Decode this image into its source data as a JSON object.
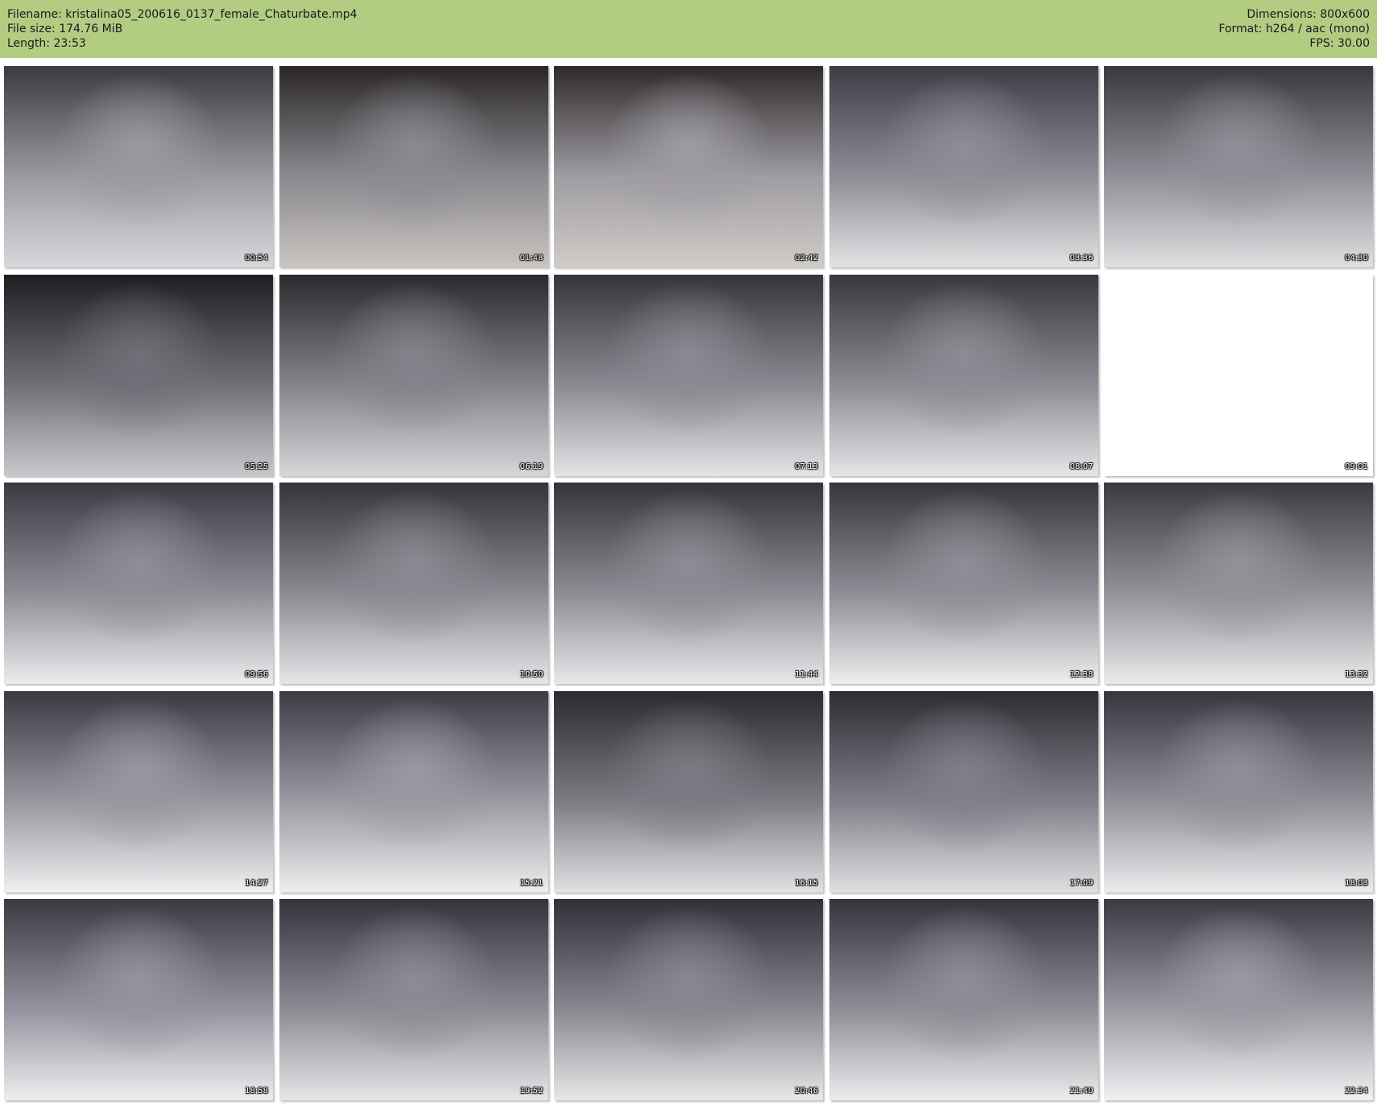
{
  "header": {
    "filename": "Filename: kristalina05_200616_0137_female_Chaturbate.mp4",
    "filesize": "File size: 174.76 MiB",
    "length": "Length: 23:53",
    "dimensions": "Dimensions: 800x600",
    "format": "Format: h264 / aac (mono)",
    "fps": "FPS: 30.00"
  },
  "colors": {
    "header_bg": "#b2cc82",
    "page_bg": "#ffffff"
  },
  "thumbnails": [
    {
      "time": "00:54"
    },
    {
      "time": "01:48"
    },
    {
      "time": "02:42"
    },
    {
      "time": "03:36"
    },
    {
      "time": "04:30"
    },
    {
      "time": "05:25"
    },
    {
      "time": "06:19"
    },
    {
      "time": "07:13"
    },
    {
      "time": "08:07"
    },
    {
      "time": "09:01"
    },
    {
      "time": "09:56"
    },
    {
      "time": "10:50"
    },
    {
      "time": "11:44"
    },
    {
      "time": "12:38"
    },
    {
      "time": "13:32"
    },
    {
      "time": "14:27"
    },
    {
      "time": "15:21"
    },
    {
      "time": "16:15"
    },
    {
      "time": "17:09"
    },
    {
      "time": "18:03"
    },
    {
      "time": "18:58"
    },
    {
      "time": "19:52"
    },
    {
      "time": "20:46"
    },
    {
      "time": "21:40"
    },
    {
      "time": "22:34"
    }
  ]
}
